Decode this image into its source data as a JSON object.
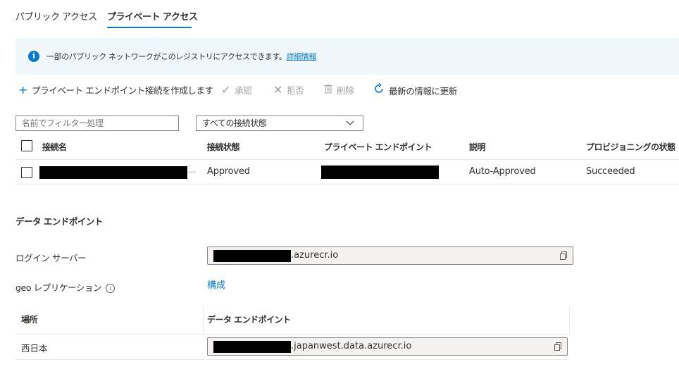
{
  "tabs": [
    {
      "label": "パブリック アクセス",
      "active": false
    },
    {
      "label": "プライベート アクセス",
      "active": true
    }
  ],
  "infobar": {
    "icon": "info-icon",
    "text": "一部のパブリック ネットワークがこのレジストリにアクセスできます。",
    "link": "詳細情報"
  },
  "toolbar": {
    "create_label": "プライベート エンドポイント接続を作成します",
    "approve_label": "承認",
    "reject_label": "拒否",
    "delete_label": "削除",
    "refresh_label": "最新の情報に更新"
  },
  "filter": {
    "placeholder": "名前でフィルター処理",
    "dropdown_value": "すべての接続状態"
  },
  "connections_table": {
    "headers": [
      "接続名",
      "接続状態",
      "プライベート エンドポイント",
      "説明",
      "プロビジョニングの状態"
    ],
    "rows": [
      {
        "name_suffix": "···",
        "state": "Approved",
        "description": "Auto-Approved",
        "provisioning": "Succeeded"
      }
    ]
  },
  "data_endpoint": {
    "section_title": "データ エンドポイント",
    "login_server_label": "ログイン サーバー",
    "login_server_suffix": ".azurecr.io",
    "geo_label": "geo レプリケーション",
    "geo_link": "構成",
    "table_headers": [
      "場所",
      "データ エンドポイント"
    ],
    "rows": [
      {
        "location": "西日本",
        "endpoint_suffix": ".japanwest.data.azurecr.io"
      }
    ]
  },
  "colors": {
    "accent": "#0078d4",
    "infobar_bg": "#eff6fc",
    "disabled": "#a19f9d"
  }
}
